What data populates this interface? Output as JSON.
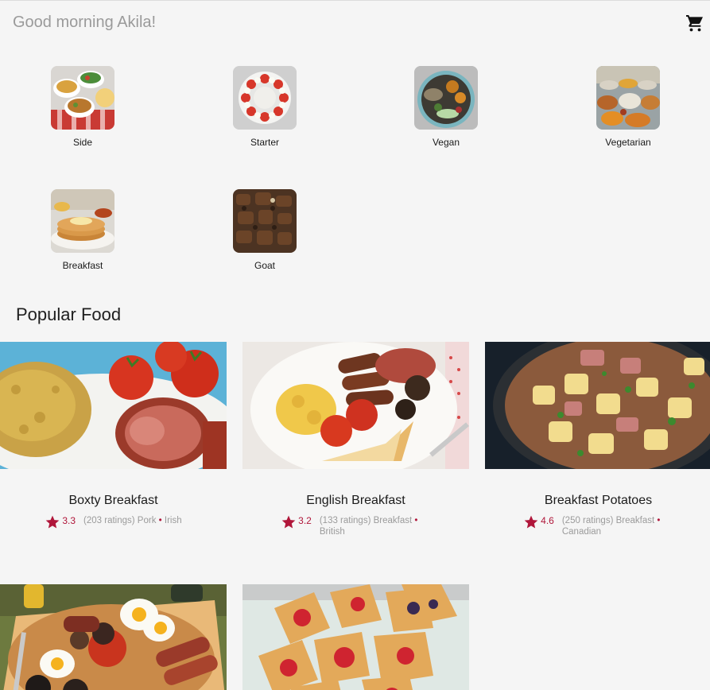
{
  "header": {
    "greeting": "Good morning Akila!"
  },
  "categories": [
    {
      "label": "Side"
    },
    {
      "label": "Starter"
    },
    {
      "label": "Vegan"
    },
    {
      "label": "Vegetarian"
    },
    {
      "label": "Breakfast"
    },
    {
      "label": "Goat"
    }
  ],
  "popular": {
    "title": "Popular Food",
    "items": [
      {
        "name": "Boxty Breakfast",
        "rating": "3.3",
        "ratings_text": "(203 ratings) Pork",
        "area": "Irish"
      },
      {
        "name": "English Breakfast",
        "rating": "3.2",
        "ratings_text": "(133 ratings) Breakfast",
        "area": "British"
      },
      {
        "name": "Breakfast Potatoes",
        "rating": "4.6",
        "ratings_text": "(250 ratings) Breakfast",
        "area": "Canadian"
      }
    ]
  },
  "colors": {
    "accent": "#b0163a",
    "background": "#f5f5f5",
    "muted_text": "#9b9b9b"
  },
  "icons": {
    "cart": "shopping-cart-icon",
    "star": "star-icon"
  }
}
